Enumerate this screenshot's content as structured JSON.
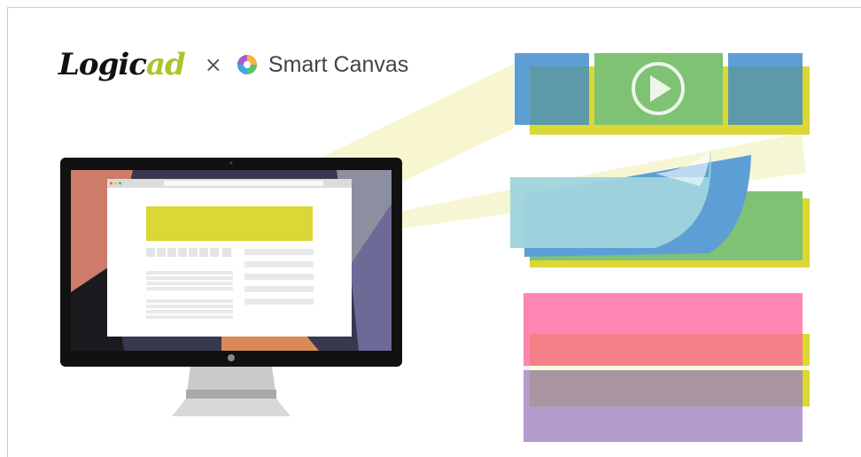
{
  "header": {
    "logo_prefix": "Logic",
    "logo_accent": "ad",
    "times_sign": "×",
    "partner_name": "Smart Canvas"
  },
  "colors": {
    "lime": "#dbd734",
    "blue": "#5d9fd4",
    "green": "#7fc273",
    "teal": "#5c9aa9",
    "light_blue": "#9fd4dd",
    "pink": "#ff86b2",
    "purple": "#b39ccb",
    "beam": "#f6f5cc"
  },
  "icons": {
    "play": "play-icon",
    "monitor_logo": "apple-icon"
  }
}
